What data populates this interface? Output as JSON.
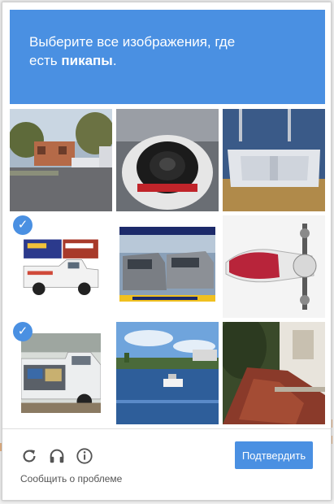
{
  "header": {
    "instruction_line1": "Выберите все изображения, где",
    "instruction_prefix": "есть",
    "instruction_target": "пикапы",
    "instruction_suffix": "."
  },
  "grid": {
    "tiles": [
      {
        "index": 0,
        "content": "street-with-trucks-photo",
        "selected": false
      },
      {
        "index": 1,
        "content": "subwoofer-speaker-photo",
        "selected": false
      },
      {
        "index": 2,
        "content": "inflatable-boat-photo",
        "selected": false
      },
      {
        "index": 3,
        "content": "pickup-truck-with-billboard-photo",
        "selected": true
      },
      {
        "index": 4,
        "content": "vans-advertisement-photo",
        "selected": false
      },
      {
        "index": 5,
        "content": "scooter-photo",
        "selected": false
      },
      {
        "index": 6,
        "content": "pickup-truck-bed-photo",
        "selected": true
      },
      {
        "index": 7,
        "content": "river-boat-photo",
        "selected": false
      },
      {
        "index": 8,
        "content": "stone-path-photo",
        "selected": false
      }
    ],
    "check_glyph": "✓"
  },
  "footer": {
    "reload_icon": "reload-icon",
    "audio_icon": "headphones-icon",
    "info_icon": "info-icon",
    "verify_label": "Подтвердить",
    "report_label": "Сообщить о проблеме"
  },
  "colors": {
    "accent": "#4a90e2",
    "icon_gray": "#555555"
  }
}
